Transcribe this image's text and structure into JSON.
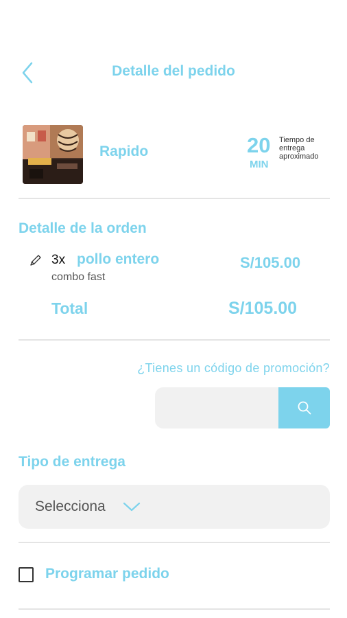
{
  "header": {
    "title": "Detalle del pedido"
  },
  "restaurant": {
    "name": "Rapido",
    "eta_value": "20",
    "eta_unit": "MIN",
    "eta_label": "Tiempo de entrega aproximado"
  },
  "order": {
    "section_title": "Detalle de la orden",
    "items": [
      {
        "qty": "3x",
        "name": "pollo entero",
        "description": "combo fast",
        "price": "S/105.00"
      }
    ],
    "total_label": "Total",
    "total_value": "S/105.00"
  },
  "promo": {
    "question": "¿Tienes un código de promoción?",
    "input_value": "",
    "input_placeholder": ""
  },
  "delivery": {
    "section_title": "Tipo de entrega",
    "selected": "Selecciona"
  },
  "schedule": {
    "label": "Programar pedido",
    "checked": false
  },
  "colors": {
    "accent": "#7dd3ec",
    "field_bg": "#f1f1f1",
    "divider": "#e4e4e4"
  },
  "icons": [
    "back-chevron-icon",
    "pencil-icon",
    "search-icon",
    "chevron-down-icon"
  ]
}
